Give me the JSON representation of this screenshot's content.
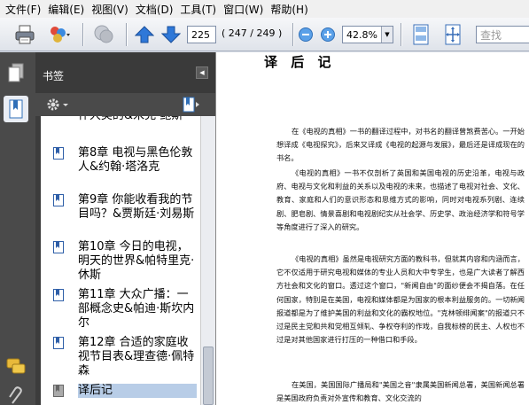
{
  "menu": {
    "items": [
      "文件(F)",
      "编辑(E)",
      "视图(V)",
      "文档(D)",
      "工具(T)",
      "窗口(W)",
      "帮助(H)"
    ]
  },
  "toolbar": {
    "current_page": "225",
    "page_count": "( 247 / 249 )",
    "zoom": "42.8%",
    "search_placeholder": "查找"
  },
  "sidebar": {
    "title": "书签",
    "bookmarks": [
      {
        "label": "怀大美的&米克·鲍斯",
        "selected": false
      },
      {
        "label": "第8章 电视与黑色伦敦人&约翰·塔洛克",
        "selected": false
      },
      {
        "label": "第9章 你能收看我的节目吗？&贾斯廷·刘易斯",
        "selected": false
      },
      {
        "label": "第10章 今日的电视，明天的世界&帕特里克·休斯",
        "selected": false
      },
      {
        "label": "第11章 大众广播：一部概念史&帕迪·斯坎内尔",
        "selected": false
      },
      {
        "label": "第12章 合适的家庭收视节目表&理查德·佩特森",
        "selected": false
      },
      {
        "label": "译后记",
        "selected": true
      }
    ]
  },
  "document": {
    "title": "译 后 记",
    "paragraphs": [
      "在《电视的真相》一书的翻译过程中，对书名的翻译曾煞费苦心。一开始想译成《电视探究》，后来又译成《电视的起源与发展》，最后还是译成现在的书名。",
      "《电视的真相》一书不仅剖析了英国和美国电视的历史沿革，电视与政府、电视与文化和利益的关系以及电视的未来，也描述了电视对社会、文化、教育、家庭和人们的意识形态和思维方式的影响，同时对电视系列剧、连续剧、肥皂剧、情景喜剧和电视剧纪实从社会学、历史学、政治经济学和符号学等角度进行了深入的研究。",
      "《电视的真相》虽然是电视研究方面的教科书，但就其内容和内涵而言，它不仅适用于研究电视和媒体的专业人员和大中专学生，也是广大读者了解西方社会和文化的窗口。透过这个窗口，\"新闻自由\"的面纱便会不揭自落。在任何国家，特别是在美国，电视和媒体都是为国家的根本利益服务的。一切新闻报道都是为了维护美国的利益和文化的霸权地位。\"克林顿绯闻案\"的报道只不过是民主党和共和党相互倾轧、争权夺利的作戏，自我标榜的民主、人权也不过是对其他国家进行打压的一种借口和手段。",
      "在美国，美国国际广播局和\"美国之音\"隶属美国新闻总署，美国新闻总署是美国政府负责对外宣传和教育、文化交流的"
    ]
  }
}
